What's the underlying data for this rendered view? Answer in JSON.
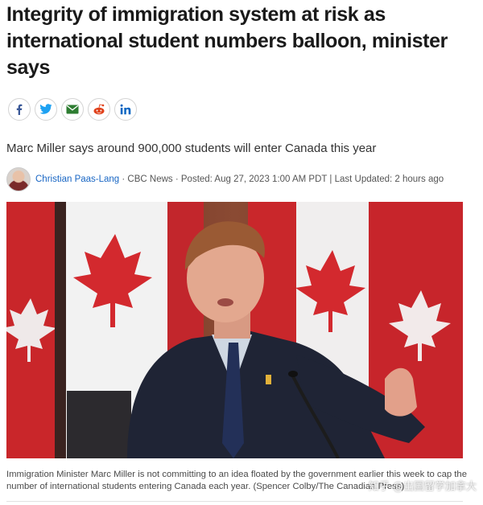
{
  "article": {
    "headline": "Integrity of immigration system at risk as international student numbers balloon, minister says",
    "subheadline": "Marc Miller says around 900,000 students will enter Canada this year",
    "author": "Christian Paas-Lang",
    "byline_rest": " · CBC News · Posted: Aug 27, 2023 1:00 AM PDT | Last Updated: 2 hours ago",
    "caption": "Immigration Minister Marc Miller is not committing to an idea floated by the government earlier this week to cap the number of international students entering Canada each year. (Spencer Colby/The Canadian Press)"
  },
  "share": [
    {
      "name": "facebook-icon",
      "color": "#3b5998"
    },
    {
      "name": "twitter-icon",
      "color": "#1da1f2"
    },
    {
      "name": "email-icon",
      "color": "#2e7d32"
    },
    {
      "name": "reddit-icon",
      "color": "#e0411b"
    },
    {
      "name": "linkedin-icon",
      "color": "#0a66c2"
    }
  ],
  "watermark": "知乎 @出国留学加拿大"
}
